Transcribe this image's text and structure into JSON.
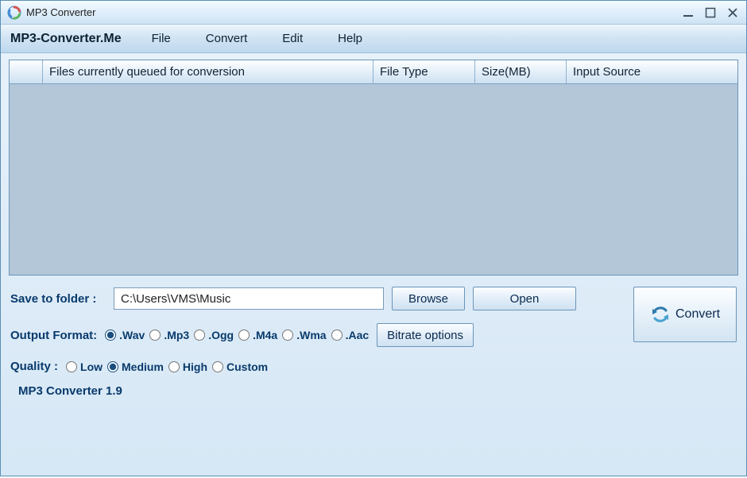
{
  "window": {
    "title": "MP3 Converter"
  },
  "menubar": {
    "brand": "MP3-Converter.Me",
    "items": [
      {
        "label": "File"
      },
      {
        "label": "Convert"
      },
      {
        "label": "Edit"
      },
      {
        "label": "Help"
      }
    ]
  },
  "table": {
    "columns": [
      {
        "label": ""
      },
      {
        "label": "Files currently queued for conversion"
      },
      {
        "label": "File Type"
      },
      {
        "label": "Size(MB)"
      },
      {
        "label": "Input Source"
      }
    ],
    "rows": []
  },
  "save": {
    "label": "Save to folder :",
    "path": "C:\\Users\\VMS\\Music",
    "browse": "Browse",
    "open": "Open"
  },
  "format": {
    "label": "Output Format:",
    "options": [
      {
        "label": ".Wav",
        "checked": true
      },
      {
        "label": ".Mp3",
        "checked": false
      },
      {
        "label": ".Ogg",
        "checked": false
      },
      {
        "label": ".M4a",
        "checked": false
      },
      {
        "label": ".Wma",
        "checked": false
      },
      {
        "label": ".Aac",
        "checked": false
      }
    ],
    "bitrate_button": "Bitrate options"
  },
  "quality": {
    "label": "Quality :",
    "options": [
      {
        "label": "Low",
        "checked": false
      },
      {
        "label": "Medium",
        "checked": true
      },
      {
        "label": "High",
        "checked": false
      },
      {
        "label": "Custom",
        "checked": false
      }
    ]
  },
  "convert": {
    "label": "Convert"
  },
  "footer": {
    "version": "MP3 Converter 1.9"
  }
}
